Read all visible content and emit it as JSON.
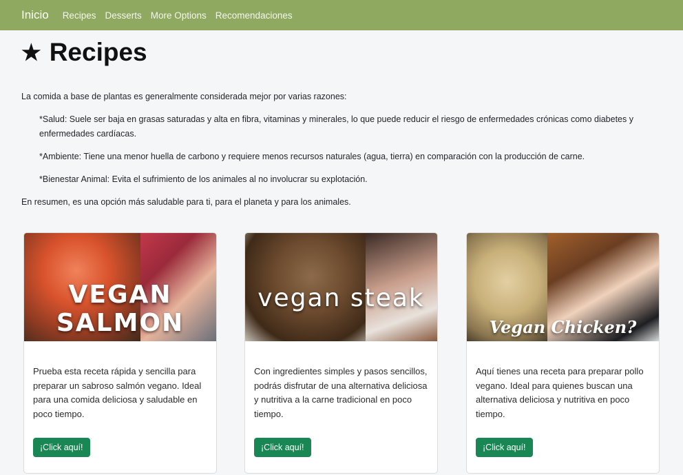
{
  "nav": {
    "brand": "Inicio",
    "links": [
      "Recipes",
      "Desserts",
      "More Options",
      "Recomendaciones"
    ]
  },
  "page": {
    "title_icon": "★",
    "title": "Recipes"
  },
  "intro": {
    "lead": "La comida a base de plantas es generalmente considerada mejor por varias razones:",
    "reasons": [
      "*Salud: Suele ser baja en grasas saturadas y alta en fibra, vitaminas y minerales, lo que puede reducir el riesgo de enfermedades crónicas como diabetes y enfermedades cardíacas.",
      "*Ambiente: Tiene una menor huella de carbono y requiere menos recursos naturales (agua, tierra) en comparación con la producción de carne.",
      "*Bienestar Animal: Evita el sufrimiento de los animales al no involucrar su explotación."
    ],
    "summary": "En resumen, es una opción más saludable para ti, para el planeta y para los animales."
  },
  "cards": [
    {
      "image_caption": "VEGAN SALMON",
      "text": "Prueba esta receta rápida y sencilla para preparar un sabroso salmón vegano. Ideal para una comida deliciosa y saludable en poco tiempo.",
      "button": "¡Click aquí!"
    },
    {
      "image_caption": "vegan steak",
      "text": "Con ingredientes simples y pasos sencillos, podrás disfrutar de una alternativa deliciosa y nutritiva a la carne tradicional en poco tiempo.",
      "button": "¡Click aquí!"
    },
    {
      "image_caption": "Vegan Chicken?",
      "text": "Aquí tienes una receta para preparar pollo vegano. Ideal para quienes buscan una alternativa deliciosa y nutritiva en poco tiempo.",
      "button": "¡Click aquí!"
    }
  ],
  "colors": {
    "navbar": "#8faa60",
    "button": "#198754",
    "background": "#f5f6f8"
  }
}
